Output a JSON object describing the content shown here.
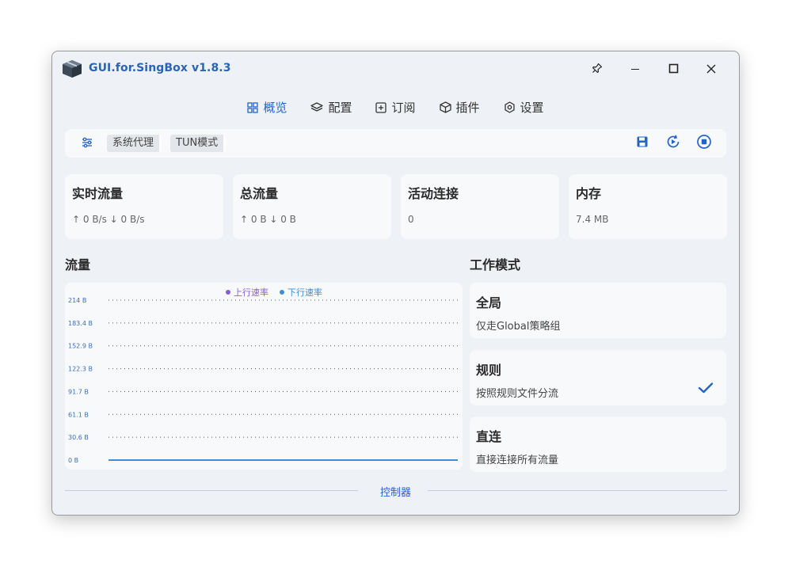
{
  "window": {
    "title": "GUI.for.SingBox v1.8.3",
    "controls": [
      "pin-icon",
      "minimize-icon",
      "maximize-icon",
      "close-icon"
    ]
  },
  "nav": [
    {
      "label": "概览",
      "icon": "dashboard-icon",
      "active": true
    },
    {
      "label": "配置",
      "icon": "layers-icon",
      "active": false
    },
    {
      "label": "订阅",
      "icon": "subscription-icon",
      "active": false
    },
    {
      "label": "插件",
      "icon": "cube-icon",
      "active": false
    },
    {
      "label": "设置",
      "icon": "gear-icon",
      "active": false
    }
  ],
  "toolbar": {
    "system_proxy": "系统代理",
    "tun_mode": "TUN模式"
  },
  "stats": {
    "realtime": {
      "title": "实时流量",
      "value": "↑ 0 B/s ↓ 0 B/s"
    },
    "total": {
      "title": "总流量",
      "value": "↑ 0 B ↓ 0 B"
    },
    "connections": {
      "title": "活动连接",
      "value": "0"
    },
    "memory": {
      "title": "内存",
      "value": "7.4 MB"
    }
  },
  "traffic": {
    "title": "流量"
  },
  "chart_data": {
    "type": "line",
    "legend": [
      "上行速率",
      "下行速率"
    ],
    "y_ticks": [
      "214 B",
      "183.4 B",
      "152.9 B",
      "122.3 B",
      "91.7 B",
      "61.1 B",
      "30.6 B",
      "0 B"
    ],
    "ylim": [
      0,
      214
    ],
    "series": [
      {
        "name": "上行速率",
        "color": "#8a5bd6",
        "values": [
          0,
          0,
          0,
          0,
          0,
          0,
          0,
          0,
          0,
          0
        ]
      },
      {
        "name": "下行速率",
        "color": "#3c8fd6",
        "values": [
          0,
          0,
          0,
          0,
          0,
          0,
          0,
          0,
          0,
          0
        ]
      }
    ],
    "grid": true,
    "legend_position": "top-center"
  },
  "work_mode": {
    "title": "工作模式",
    "modes": [
      {
        "title": "全局",
        "desc": "仅走Global策略组",
        "selected": false
      },
      {
        "title": "规则",
        "desc": "按照规则文件分流",
        "selected": true
      },
      {
        "title": "直连",
        "desc": "直接连接所有流量",
        "selected": false
      }
    ]
  },
  "footer": {
    "controller": "控制器"
  },
  "colors": {
    "accent": "#2563c9",
    "upload": "#8a5bd6",
    "download": "#3c8fd6",
    "check": "#2563c9"
  }
}
